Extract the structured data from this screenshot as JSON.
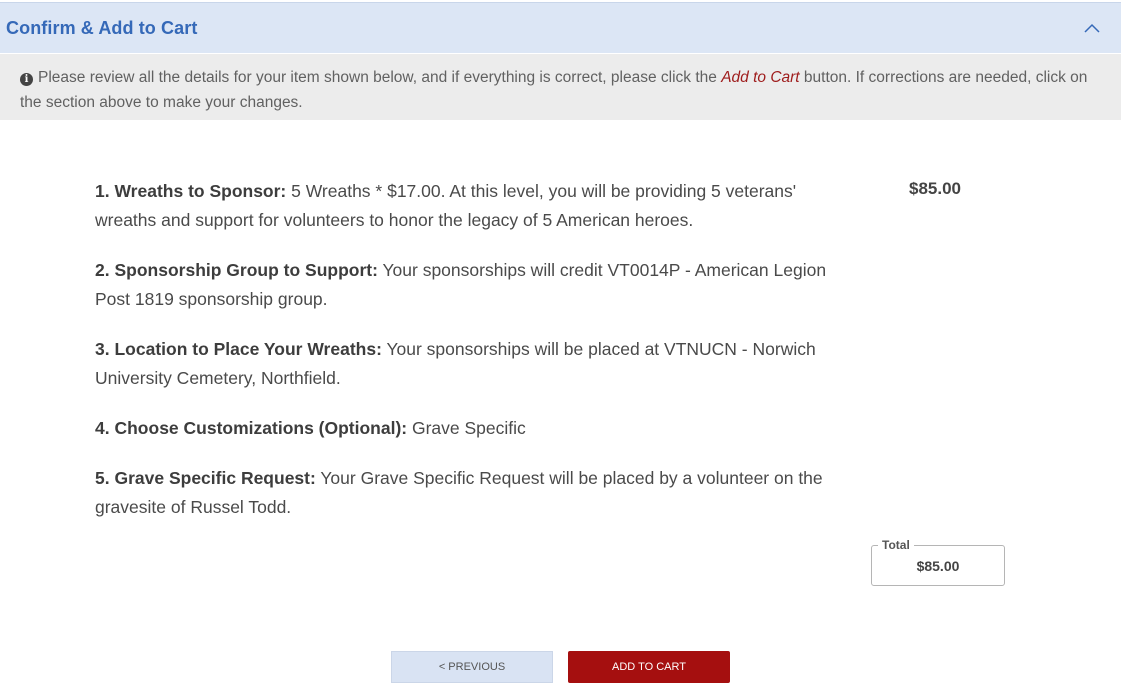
{
  "header": {
    "title": "Confirm & Add to Cart",
    "toggle_icon": "chevron-up-icon"
  },
  "notice": {
    "icon": "info-icon",
    "text_before": "Please review all the details for your item shown below, and if everything is correct, please click the ",
    "highlight": "Add to Cart",
    "text_after": " button. If corrections are needed, click on the section above to make your changes."
  },
  "items": [
    {
      "number": "1.",
      "label": "Wreaths to Sponsor:",
      "text": " 5 Wreaths * $17.00. At this level, you will be providing 5 veterans' wreaths and support for volunteers to honor the legacy of 5 American heroes."
    },
    {
      "number": "2.",
      "label": "Sponsorship Group to Support:",
      "text": " Your sponsorships will credit VT0014P - American Legion Post 1819 sponsorship group."
    },
    {
      "number": "3.",
      "label": "Location to Place Your Wreaths:",
      "text": " Your sponsorships will be placed at VTNUCN - Norwich University Cemetery, Northfield."
    },
    {
      "number": "4.",
      "label": "Choose Customizations (Optional):",
      "text": " Grave Specific"
    },
    {
      "number": "5.",
      "label": "Grave Specific Request:",
      "text": " Your Grave Specific Request will be placed by a volunteer on the gravesite of Russel Todd."
    }
  ],
  "line_price": "$85.00",
  "total": {
    "label": "Total",
    "value": "$85.00"
  },
  "buttons": {
    "previous": "< Previous",
    "add_to_cart": "Add to Cart"
  },
  "colors": {
    "accent_blue": "#3569b8",
    "header_bg": "#dce6f5",
    "add_button": "#a50f0f"
  }
}
